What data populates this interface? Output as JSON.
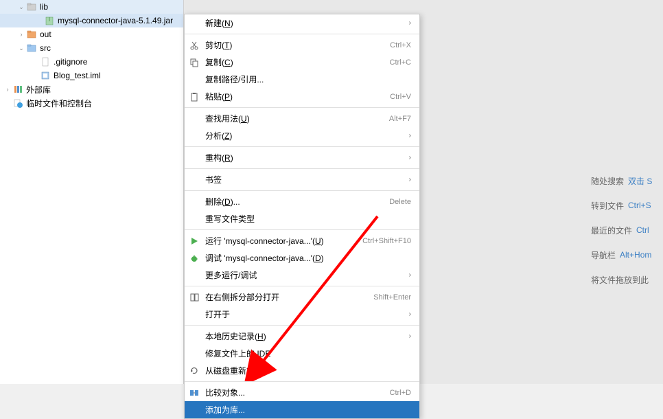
{
  "tree": {
    "lib": "lib",
    "jar": "mysql-connector-java-5.1.49.jar",
    "out": "out",
    "src": "src",
    "gitignore": ".gitignore",
    "iml": "Blog_test.iml",
    "external": "外部库",
    "scratches": "临时文件和控制台"
  },
  "menu": {
    "new": "新建",
    "new_m": "N",
    "cut": "剪切",
    "cut_m": "T",
    "cut_key": "Ctrl+X",
    "copy": "复制",
    "copy_m": "C",
    "copy_key": "Ctrl+C",
    "copy_path": "复制路径/引用...",
    "paste": "粘贴",
    "paste_m": "P",
    "paste_key": "Ctrl+V",
    "find_usages": "查找用法",
    "find_usages_m": "U",
    "find_usages_key": "Alt+F7",
    "analyze": "分析",
    "analyze_m": "Z",
    "refactor": "重构",
    "refactor_m": "R",
    "bookmarks": "书签",
    "delete": "删除",
    "delete_m": "D",
    "delete_key": "Delete",
    "override_ft": "重写文件类型",
    "run": "运行 'mysql-connector-java...'",
    "run_m": "U",
    "run_key": "Ctrl+Shift+F10",
    "debug": "调试 'mysql-connector-java...'",
    "debug_m": "D",
    "more_run": "更多运行/调试",
    "open_split": "在右侧拆分部分打开",
    "open_split_key": "Shift+Enter",
    "open_in": "打开于",
    "local_history": "本地历史记录",
    "local_history_m": "H",
    "repair_ide": "修复文件上的 IDE",
    "reload_disk": "从磁盘重新加载",
    "compare": "比较对象...",
    "compare_key": "Ctrl+D",
    "add_as_library": "添加为库..."
  },
  "tips": {
    "search_label": "随处搜索",
    "search_key": "双击 S",
    "goto_label": "转到文件",
    "goto_key": "Ctrl+S",
    "recent_label": "最近的文件",
    "recent_key": "Ctrl",
    "navbar_label": "导航栏",
    "navbar_key": "Alt+Hom",
    "drop_label": "将文件拖放到此"
  }
}
